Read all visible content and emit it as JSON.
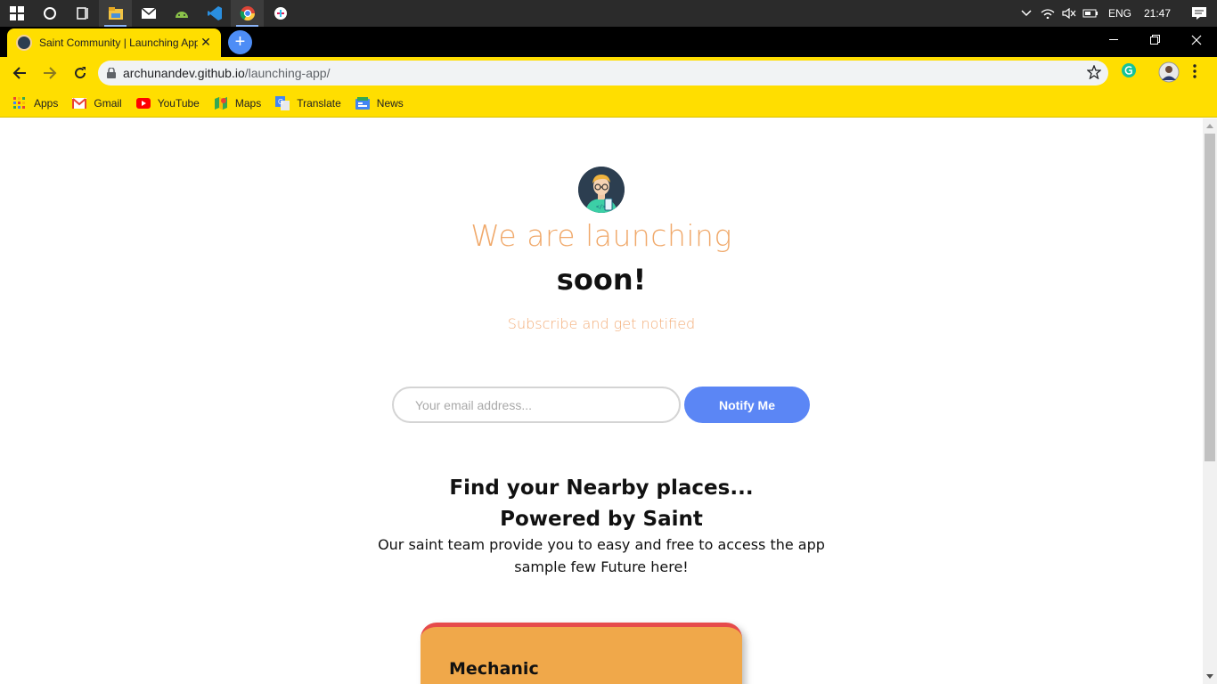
{
  "taskbar": {
    "apps": [
      {
        "name": "cortana-icon"
      },
      {
        "name": "task-view-icon"
      },
      {
        "name": "file-explorer-icon"
      },
      {
        "name": "mail-icon"
      },
      {
        "name": "android-studio-icon"
      },
      {
        "name": "vscode-icon"
      },
      {
        "name": "chrome-icon"
      },
      {
        "name": "slack-icon"
      }
    ],
    "language": "ENG",
    "time": "21:47"
  },
  "browser": {
    "tab_title": "Saint Community | Launching App",
    "url_host": "archunandev.github.io",
    "url_path": "/launching-app/",
    "bookmarks": [
      {
        "label": "Apps",
        "icon": "apps-grid-icon"
      },
      {
        "label": "Gmail",
        "icon": "gmail-icon"
      },
      {
        "label": "YouTube",
        "icon": "youtube-icon"
      },
      {
        "label": "Maps",
        "icon": "maps-icon"
      },
      {
        "label": "Translate",
        "icon": "translate-icon"
      },
      {
        "label": "News",
        "icon": "news-icon"
      }
    ],
    "colors": {
      "theme": "#ffde00"
    }
  },
  "page": {
    "heading_light": "We are launching",
    "heading_bold": "soon!",
    "subtitle": "Subscribe and get notified",
    "email_placeholder": "Your email address...",
    "notify_label": "Notify Me",
    "find_line1": "Find your Nearby places...",
    "find_line2": "Powered by Saint",
    "desc_line1": "Our saint team provide you to easy and free to access the app",
    "desc_line2": "sample few Future here!",
    "card_title": "Mechanic",
    "colors": {
      "accent": "#f0a96b",
      "button": "#5b86f5",
      "card": "#f0a84a",
      "card_border": "#e64b4b"
    }
  }
}
